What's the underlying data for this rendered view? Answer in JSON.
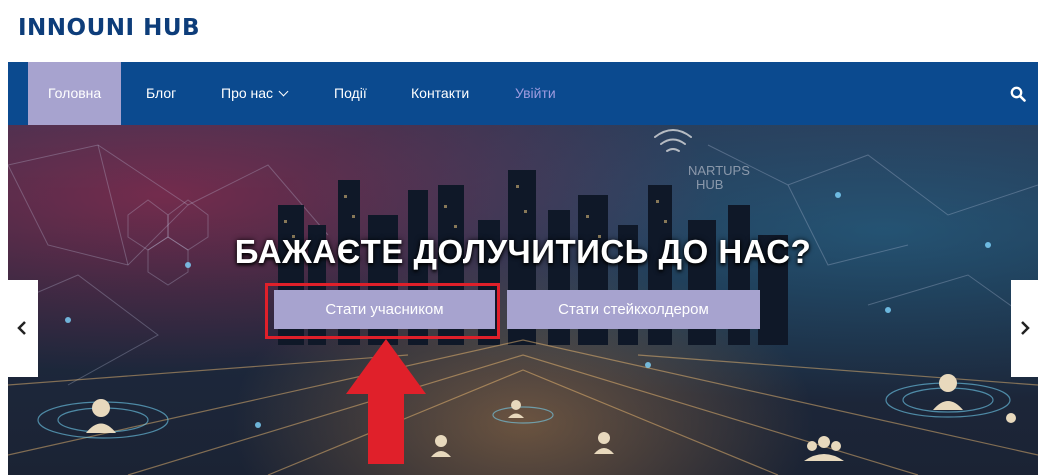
{
  "header": {
    "logo": "INNOUNI HUB"
  },
  "nav": {
    "items": [
      {
        "label": "Головна",
        "active": true
      },
      {
        "label": "Блог"
      },
      {
        "label": "Про нас",
        "has_dropdown": true
      },
      {
        "label": "Події"
      },
      {
        "label": "Контакти"
      },
      {
        "label": "Увійти"
      }
    ],
    "search_icon": "search-icon"
  },
  "hero": {
    "title": "БАЖАЄТЕ ДОЛУЧИТИСЬ ДО НАС?",
    "primary_button": "Стати учасником",
    "secondary_button": "Стати стейкхолдером",
    "prev_icon": "chevron-left-icon",
    "next_icon": "chevron-right-icon",
    "annotation_color": "#e0202a"
  },
  "colors": {
    "brand": "#0d3d7a",
    "nav_bg": "#0b4a8f",
    "accent": "#a7a3cf",
    "login_text": "#9f9ce0"
  }
}
